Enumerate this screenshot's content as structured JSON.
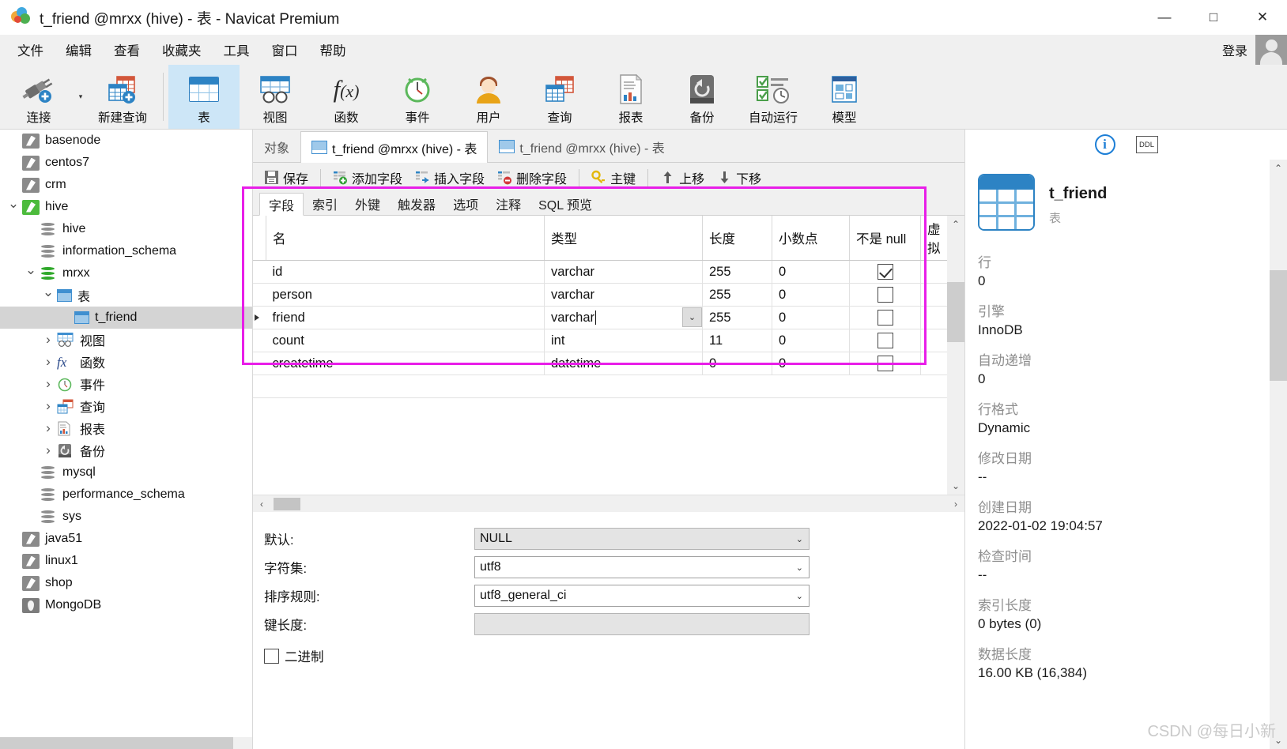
{
  "window": {
    "title": "t_friend @mrxx (hive) - 表 - Navicat Premium",
    "minimize": "—",
    "maximize": "□",
    "close": "✕"
  },
  "menubar": {
    "items": [
      "文件",
      "编辑",
      "查看",
      "收藏夹",
      "工具",
      "窗口",
      "帮助"
    ],
    "login_label": "登录"
  },
  "ribbon": {
    "items": [
      {
        "label": "连接",
        "icon": "connection-icon"
      },
      {
        "label": "新建查询",
        "icon": "new-query-icon"
      },
      {
        "label": "表",
        "icon": "table-icon",
        "selected": true
      },
      {
        "label": "视图",
        "icon": "view-icon"
      },
      {
        "label": "函数",
        "icon": "function-icon"
      },
      {
        "label": "事件",
        "icon": "event-icon"
      },
      {
        "label": "用户",
        "icon": "user-icon"
      },
      {
        "label": "查询",
        "icon": "query-icon"
      },
      {
        "label": "报表",
        "icon": "report-icon"
      },
      {
        "label": "备份",
        "icon": "backup-icon"
      },
      {
        "label": "自动运行",
        "icon": "automation-icon"
      },
      {
        "label": "模型",
        "icon": "model-icon"
      }
    ]
  },
  "sidebar": {
    "items": [
      {
        "label": "basenode",
        "icon": "connection-icon",
        "indent": 0,
        "twisty": "",
        "type": "conn"
      },
      {
        "label": "centos7",
        "icon": "connection-icon",
        "indent": 0,
        "twisty": "",
        "type": "conn"
      },
      {
        "label": "crm",
        "icon": "connection-icon",
        "indent": 0,
        "twisty": "",
        "type": "conn"
      },
      {
        "label": "hive",
        "icon": "connection-icon-active",
        "indent": 0,
        "twisty": "open",
        "type": "conn-green"
      },
      {
        "label": "hive",
        "icon": "database-icon",
        "indent": 1,
        "twisty": "",
        "type": "db"
      },
      {
        "label": "information_schema",
        "icon": "database-icon",
        "indent": 1,
        "twisty": "",
        "type": "db"
      },
      {
        "label": "mrxx",
        "icon": "database-icon-active",
        "indent": 1,
        "twisty": "open",
        "type": "db-green"
      },
      {
        "label": "表",
        "icon": "table-icon",
        "indent": 2,
        "twisty": "open",
        "type": "grid"
      },
      {
        "label": "t_friend",
        "icon": "table-icon",
        "indent": 3,
        "twisty": "",
        "type": "grid",
        "selected": true
      },
      {
        "label": "视图",
        "icon": "view-icon",
        "indent": 2,
        "twisty": "closed",
        "type": "view"
      },
      {
        "label": "函数",
        "icon": "function-icon",
        "indent": 2,
        "twisty": "closed",
        "type": "fx"
      },
      {
        "label": "事件",
        "icon": "event-icon",
        "indent": 2,
        "twisty": "closed",
        "type": "event"
      },
      {
        "label": "查询",
        "icon": "query-icon",
        "indent": 2,
        "twisty": "closed",
        "type": "query"
      },
      {
        "label": "报表",
        "icon": "report-icon",
        "indent": 2,
        "twisty": "closed",
        "type": "report"
      },
      {
        "label": "备份",
        "icon": "backup-icon",
        "indent": 2,
        "twisty": "closed",
        "type": "backup"
      },
      {
        "label": "mysql",
        "icon": "database-icon",
        "indent": 1,
        "twisty": "",
        "type": "db"
      },
      {
        "label": "performance_schema",
        "icon": "database-icon",
        "indent": 1,
        "twisty": "",
        "type": "db"
      },
      {
        "label": "sys",
        "icon": "database-icon",
        "indent": 1,
        "twisty": "",
        "type": "db"
      },
      {
        "label": "java51",
        "icon": "connection-icon",
        "indent": 0,
        "twisty": "",
        "type": "conn"
      },
      {
        "label": "linux1",
        "icon": "connection-icon",
        "indent": 0,
        "twisty": "",
        "type": "conn"
      },
      {
        "label": "shop",
        "icon": "connection-icon",
        "indent": 0,
        "twisty": "",
        "type": "conn"
      },
      {
        "label": "MongoDB",
        "icon": "mongodb-icon",
        "indent": 0,
        "twisty": "",
        "type": "mongo"
      }
    ]
  },
  "tabs": [
    {
      "label": "对象",
      "active": false,
      "has_icon": false
    },
    {
      "label": "t_friend @mrxx (hive) - 表",
      "active": true,
      "has_icon": true
    },
    {
      "label": "t_friend @mrxx (hive) - 表",
      "active": false,
      "has_icon": true
    }
  ],
  "field_toolbar": [
    {
      "label": "保存",
      "icon": "save-icon"
    },
    {
      "label": "添加字段",
      "icon": "add-field-icon"
    },
    {
      "label": "插入字段",
      "icon": "insert-field-icon"
    },
    {
      "label": "删除字段",
      "icon": "delete-field-icon"
    },
    {
      "label": "主键",
      "icon": "primary-key-icon"
    },
    {
      "label": "上移",
      "icon": "move-up-icon"
    },
    {
      "label": "下移",
      "icon": "move-down-icon"
    }
  ],
  "subtabs": [
    {
      "label": "字段",
      "active": true
    },
    {
      "label": "索引",
      "active": false
    },
    {
      "label": "外键",
      "active": false
    },
    {
      "label": "触发器",
      "active": false
    },
    {
      "label": "选项",
      "active": false
    },
    {
      "label": "注释",
      "active": false
    },
    {
      "label": "SQL 预览",
      "active": false
    }
  ],
  "grid": {
    "columns": [
      "名",
      "类型",
      "长度",
      "小数点",
      "不是 null",
      "虚拟"
    ],
    "rows": [
      {
        "name": "id",
        "type": "varchar",
        "length": "255",
        "decimals": "0",
        "notnull": true,
        "virtual": false,
        "current": false
      },
      {
        "name": "person",
        "type": "varchar",
        "length": "255",
        "decimals": "0",
        "notnull": false,
        "virtual": false,
        "current": false
      },
      {
        "name": "friend",
        "type": "varchar",
        "length": "255",
        "decimals": "0",
        "notnull": false,
        "virtual": false,
        "current": true
      },
      {
        "name": "count",
        "type": "int",
        "length": "11",
        "decimals": "0",
        "notnull": false,
        "virtual": false,
        "current": false
      },
      {
        "name": "createtime",
        "type": "datetime",
        "length": "0",
        "decimals": "0",
        "notnull": false,
        "virtual": false,
        "current": false
      }
    ]
  },
  "properties": {
    "rows": [
      {
        "label": "默认:",
        "value": "NULL",
        "kind": "select",
        "disabled": true
      },
      {
        "label": "字符集:",
        "value": "utf8",
        "kind": "select",
        "disabled": false
      },
      {
        "label": "排序规则:",
        "value": "utf8_general_ci",
        "kind": "select",
        "disabled": false
      },
      {
        "label": "键长度:",
        "value": "",
        "kind": "text",
        "disabled": true
      }
    ],
    "binary_label": "二进制",
    "binary_checked": false
  },
  "info_panel": {
    "info_icon": "i",
    "ddl_label": "DDL",
    "object_name": "t_friend",
    "object_type": "表",
    "fields": [
      {
        "key": "行",
        "value": "0"
      },
      {
        "key": "引擎",
        "value": "InnoDB"
      },
      {
        "key": "自动递增",
        "value": "0"
      },
      {
        "key": "行格式",
        "value": "Dynamic"
      },
      {
        "key": "修改日期",
        "value": "--"
      },
      {
        "key": "创建日期",
        "value": "2022-01-02 19:04:57"
      },
      {
        "key": "检查时间",
        "value": "--"
      },
      {
        "key": "索引长度",
        "value": "0 bytes (0)"
      },
      {
        "key": "数据长度",
        "value": "16.00 KB (16,384)"
      }
    ]
  },
  "watermark": "CSDN @每日小新",
  "colors": {
    "highlight_box": "#e81ee8",
    "accent_blue": "#2d83c4",
    "selected_tab_bg": "#cde6f7"
  }
}
